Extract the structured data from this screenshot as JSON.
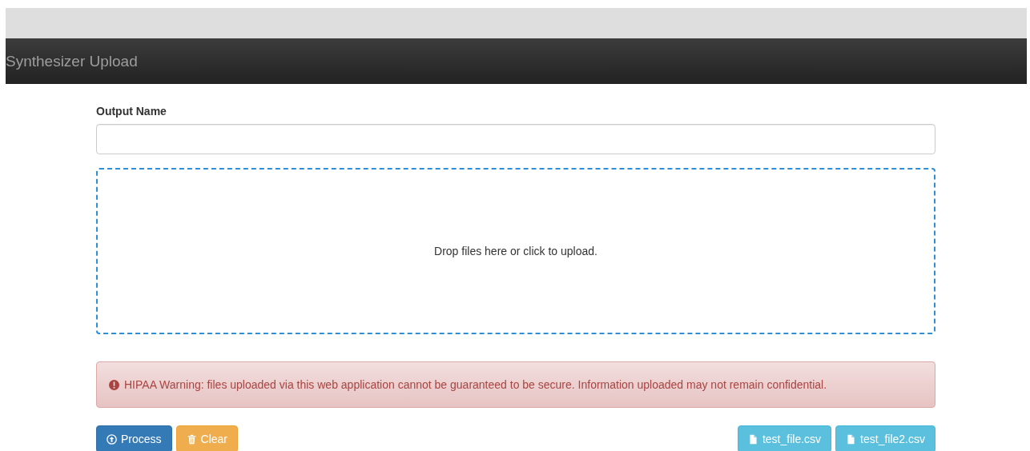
{
  "navbar": {
    "title": "Synthesizer Upload"
  },
  "form": {
    "label": "Output Name"
  },
  "dropzone": {
    "text": "Drop files here or click to upload."
  },
  "alert": {
    "text": "HIPAA Warning: files uploaded via this web application cannot be guaranteed to be secure. Information uploaded may not remain confidential."
  },
  "actions": [
    {
      "kind": "process",
      "label": "Process"
    },
    {
      "kind": "clear",
      "label": "Clear"
    }
  ],
  "files": [
    {
      "label": "test_file.csv"
    },
    {
      "label": "test_file2.csv"
    }
  ]
}
